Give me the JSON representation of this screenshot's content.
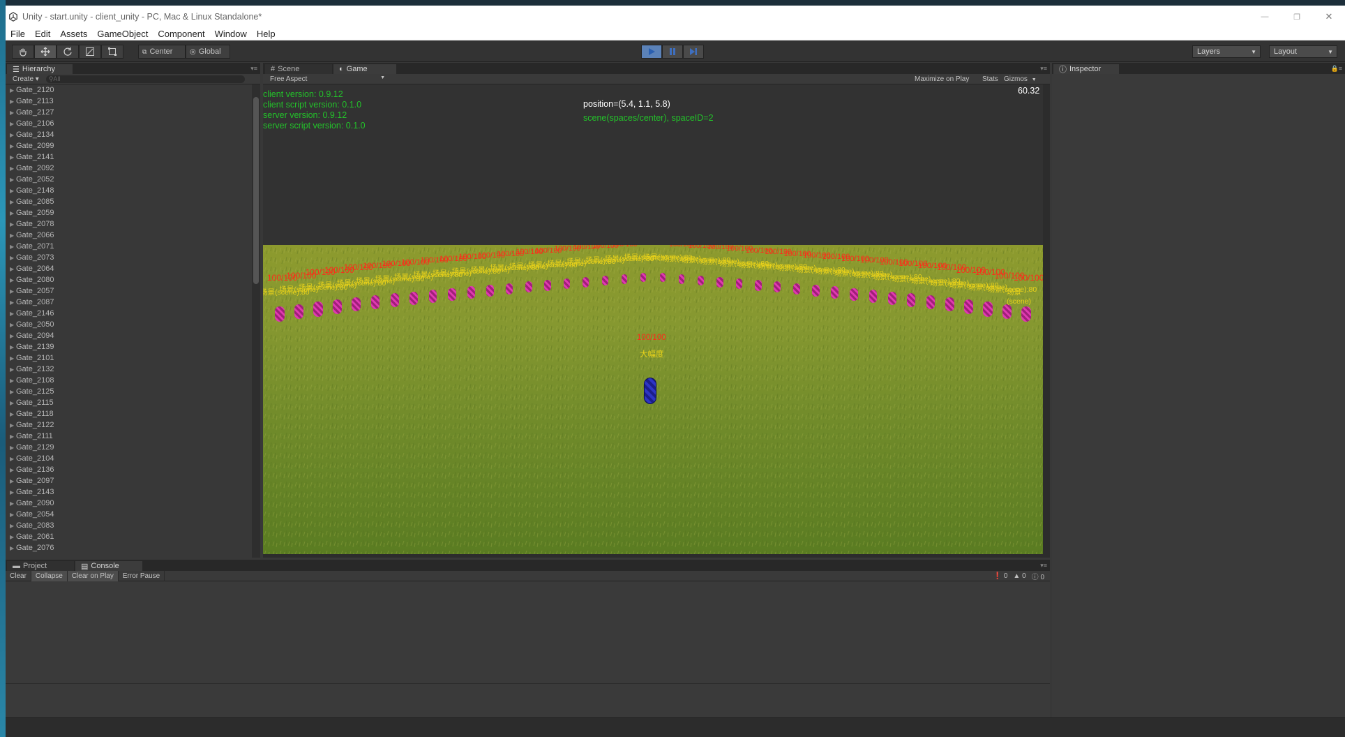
{
  "window": {
    "title": "Unity - start.unity - client_unity - PC, Mac & Linux Standalone*",
    "controls": {
      "minimize": "—",
      "restore": "❐",
      "close": "✕"
    }
  },
  "menu": [
    "File",
    "Edit",
    "Assets",
    "GameObject",
    "Component",
    "Window",
    "Help"
  ],
  "toolbar": {
    "pivot_label": "Center",
    "space_label": "Global",
    "layers_label": "Layers",
    "layout_label": "Layout"
  },
  "hierarchy": {
    "tab_label": "Hierarchy",
    "create_label": "Create",
    "search_placeholder": "All",
    "items": [
      "Gate_2120",
      "Gate_2113",
      "Gate_2127",
      "Gate_2106",
      "Gate_2134",
      "Gate_2099",
      "Gate_2141",
      "Gate_2092",
      "Gate_2052",
      "Gate_2148",
      "Gate_2085",
      "Gate_2059",
      "Gate_2078",
      "Gate_2066",
      "Gate_2071",
      "Gate_2073",
      "Gate_2064",
      "Gate_2080",
      "Gate_2057",
      "Gate_2087",
      "Gate_2146",
      "Gate_2050",
      "Gate_2094",
      "Gate_2139",
      "Gate_2101",
      "Gate_2132",
      "Gate_2108",
      "Gate_2125",
      "Gate_2115",
      "Gate_2118",
      "Gate_2122",
      "Gate_2111",
      "Gate_2129",
      "Gate_2104",
      "Gate_2136",
      "Gate_2097",
      "Gate_2143",
      "Gate_2090",
      "Gate_2054",
      "Gate_2083",
      "Gate_2061",
      "Gate_2076"
    ]
  },
  "center_panel": {
    "tabs": [
      "Scene",
      "Game"
    ],
    "aspect_label": "Free Aspect",
    "maximize_label": "Maximize on Play",
    "stats_label": "Stats",
    "gizmos_label": "Gizmos"
  },
  "game": {
    "info_lines": [
      "client version: 0.9.12",
      "client script version: 0.1.0",
      "server version: 0.9.12",
      "server script version: 0.1.0"
    ],
    "position": "position=(5.4, 1.1, 5.8)",
    "scene_info": "scene(spaces/center), spaceID=2",
    "fps": "60.32",
    "player_hp": "100/100",
    "player_name": "大幅度",
    "npc_hp": "100/100",
    "npc_label": "场景(scene)",
    "npc_label_with_id": "场景(scene):80"
  },
  "inspector": {
    "tab_label": "Inspector"
  },
  "bottom": {
    "tabs": [
      "Project",
      "Console"
    ],
    "buttons": [
      "Clear",
      "Collapse",
      "Clear on Play",
      "Error Pause"
    ],
    "error_count": "0",
    "warning_count": "0",
    "log_count": "0"
  },
  "colors": {
    "hp_red": "#ff2a1a",
    "name_yellow": "#e9d21a",
    "info_green": "#23c22a",
    "play_blue": "#5b82b8"
  }
}
